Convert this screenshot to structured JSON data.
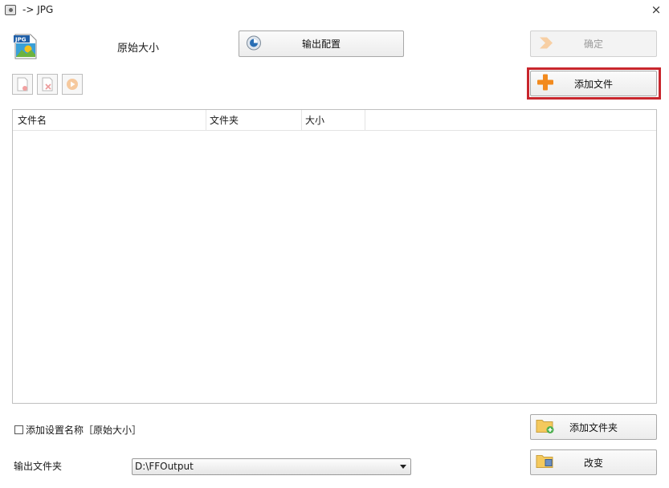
{
  "window": {
    "title": "-> JPG",
    "close_label": "×"
  },
  "format": {
    "badge": "JPG",
    "size_label": "原始大小"
  },
  "toolbar": {
    "output_config_label": "输出配置",
    "confirm_label": "确定",
    "add_file_label": "添加文件"
  },
  "file_list": {
    "columns": [
      "文件名",
      "文件夹",
      "大小"
    ],
    "rows": []
  },
  "bottom": {
    "add_setting_name_label": "添加设置名称［原始大小］",
    "add_setting_name_checked": false,
    "add_folder_label": "添加文件夹",
    "output_folder_label": "输出文件夹",
    "output_folder_value": "D:\\FFOutput",
    "change_label": "改变"
  },
  "colors": {
    "highlight": "#c8262d",
    "add_icon": "#f28a1e"
  }
}
